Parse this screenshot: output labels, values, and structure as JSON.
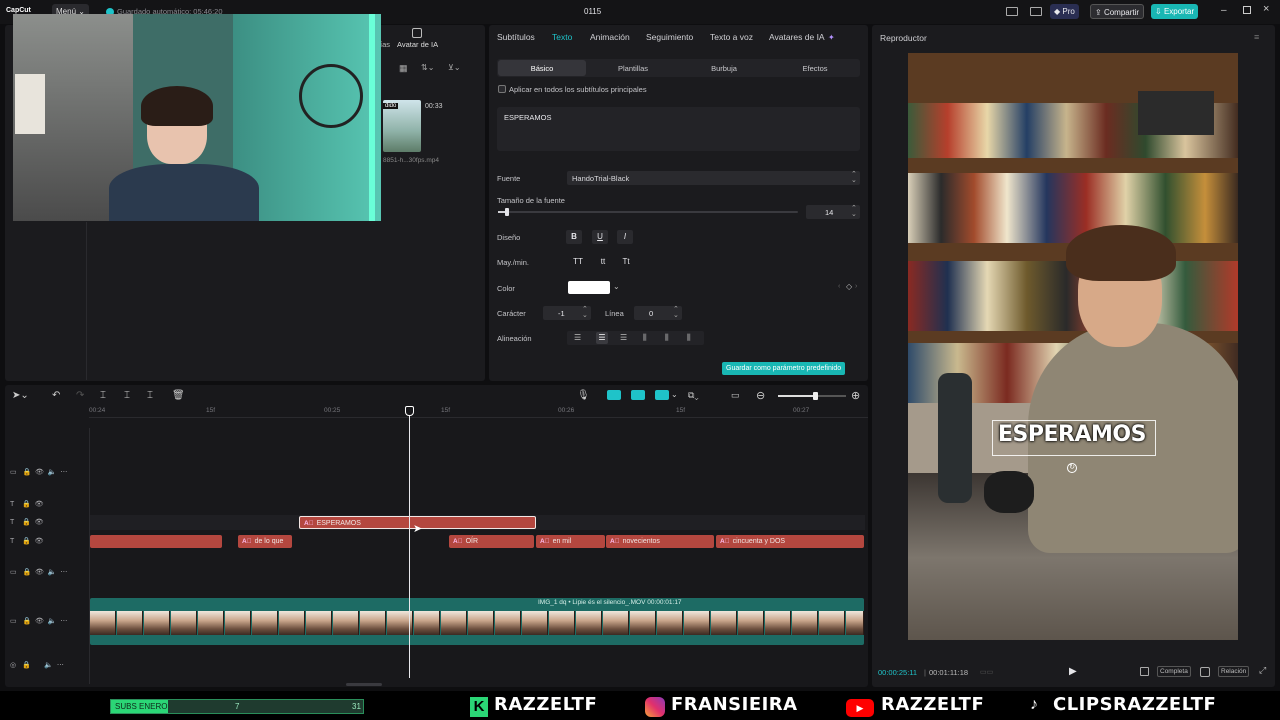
{
  "app": {
    "logo": "CapCut",
    "menu_label": "Menú",
    "autosave": "Guardado automático: 05:46:20",
    "project_title": "0115",
    "pro_label": "Pro",
    "share_label": "Compartir",
    "export_label": "Exportar"
  },
  "media": {
    "tab_ai_avatar": "Avatar de IA",
    "tab_partial": "ías",
    "thumb_duration": "00:33",
    "thumb_name": "8851-h...30fps.mp4",
    "thumb_badge": "dido"
  },
  "props": {
    "tabs": [
      "Subtítulos",
      "Texto",
      "Animación",
      "Seguimiento",
      "Texto a voz",
      "Avatares de IA"
    ],
    "active_tab": "Texto",
    "subtabs": [
      "Básico",
      "Plantillas",
      "Burbuja",
      "Efectos"
    ],
    "apply_all": "Aplicar en todos los subtítulos principales",
    "text_value": "ESPERAMOS",
    "font_label": "Fuente",
    "font_value": "HandoTrial-Black",
    "size_label": "Tamaño de la fuente",
    "size_value": "14",
    "size_level": 0.03,
    "design_label": "Diseño",
    "bold": "B",
    "underline": "U",
    "italic": "I",
    "case_label": "May./min.",
    "case_opts": [
      "TT",
      "tt",
      "Tt"
    ],
    "color_label": "Color",
    "color_value": "#ffffff",
    "char_label": "Carácter",
    "char_value": "-1",
    "line_label": "Línea",
    "line_value": "0",
    "align_label": "Alineación",
    "save_default": "Guardar como parámetro predefinido"
  },
  "player": {
    "title": "Reproductor",
    "overlay_text": "ESPERAMOS",
    "current_time": "00:00:25:11",
    "total_time": "00:01:11:18",
    "full_label": "Completa",
    "ratio_label": "Relación"
  },
  "timeline": {
    "ticks": [
      "00:24",
      "15f",
      "00:25",
      "15f",
      "00:26",
      "15f",
      "00:27"
    ],
    "selected_clip": "ESPERAMOS",
    "sub_clips": [
      "de lo que",
      "OÍR",
      "en mil",
      "novecientos",
      "cincuenta y DOS"
    ],
    "video_label": "IMG_1 dq • Lipie és el silencio_.MOV  00:00:01:17"
  },
  "overlay": {
    "subs_label": "SUBS ENERO",
    "subs_current": "7",
    "subs_goal": "31",
    "subs_progress": 0.226,
    "twitch": "RAZZELTF",
    "instagram": "FRANSIEIRA",
    "youtube": "RAZZELTF",
    "tiktok": "CLIPSRAZZELTF"
  },
  "colors": {
    "accent": "#1fc3c9",
    "clip_red": "#b4473f",
    "video_teal": "#1d6b64",
    "export_btn": "#19b7b4",
    "pro_btn": "#2a2e52"
  }
}
